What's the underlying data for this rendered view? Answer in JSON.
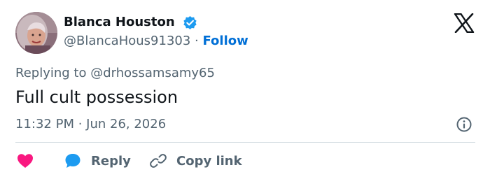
{
  "author": {
    "display_name": "Blanca Houston",
    "handle": "@BlancaHous91303",
    "separator": " · ",
    "follow_label": "Follow",
    "verified": true
  },
  "tweet": {
    "replying_prefix": "Replying to ",
    "replying_to": "@drhossamsamy65",
    "text": "Full cult possession",
    "timestamp": "11:32 PM · Jun 26, 2026"
  },
  "actions": {
    "reply_label": "Reply",
    "copy_link_label": "Copy link"
  },
  "icons": {
    "brand": "x-logo-icon",
    "verified": "verified-badge-icon",
    "info": "info-icon",
    "like": "heart-icon",
    "reply": "speech-bubble-icon",
    "copy_link": "link-icon"
  },
  "colors": {
    "text_primary": "#0f1419",
    "text_secondary": "#536471",
    "link_blue": "#006fd6",
    "verified_blue": "#1d9bf0",
    "like_pink": "#f91880",
    "divider": "#cfd9de"
  }
}
